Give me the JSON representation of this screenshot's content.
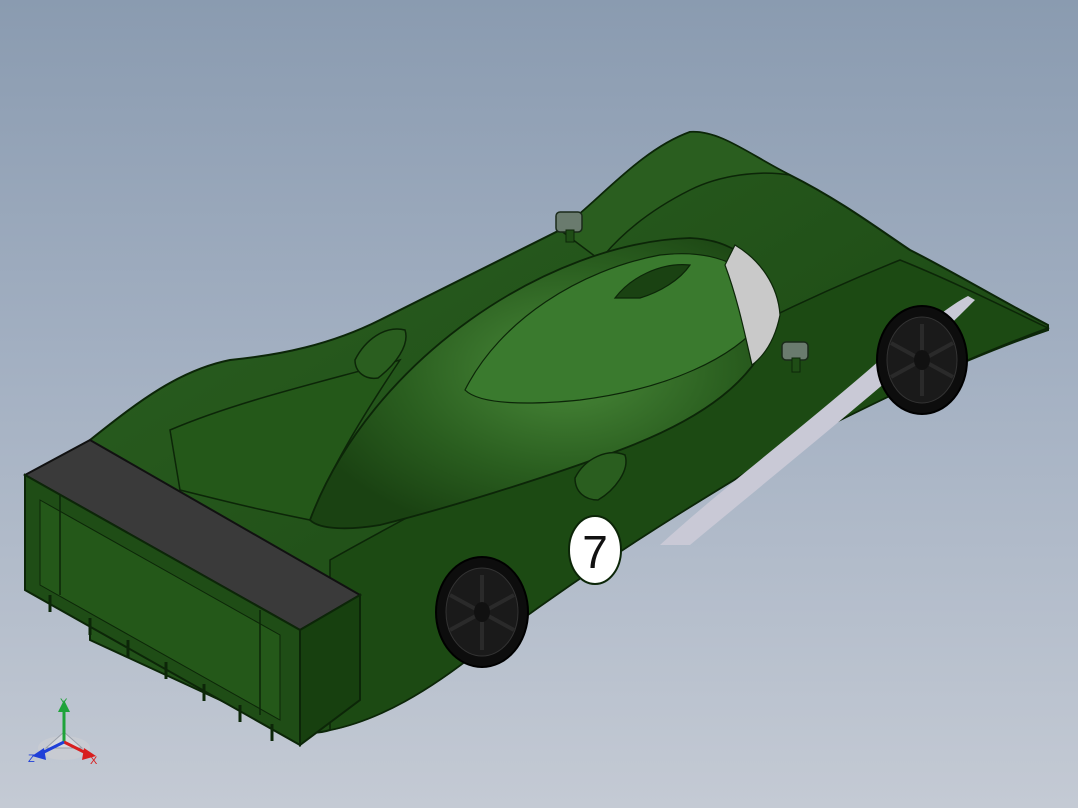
{
  "model": {
    "race_number": "7",
    "body_color": "#1f4d16",
    "wing_color": "#3a3a3a",
    "windshield_color": "#c9c9c9",
    "stripe_color": "#c9c9d6"
  },
  "triad": {
    "x_label": "X",
    "y_label": "Y",
    "z_label": "Z",
    "x_color": "#d81e1e",
    "y_color": "#1fa33a",
    "z_color": "#1f3fd8"
  }
}
